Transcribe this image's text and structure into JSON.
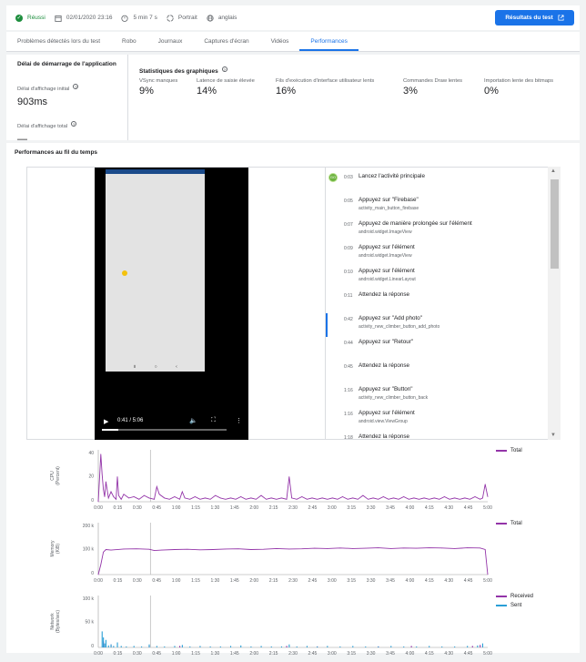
{
  "topbar": {
    "status": "Réussi",
    "date": "02/01/2020 23:16",
    "duration": "5 min 7 s",
    "orientation": "Portrait",
    "locale": "anglais",
    "results_button": "Résultats du test"
  },
  "tabs": [
    {
      "label": "Problèmes détectés lors du test"
    },
    {
      "label": "Robo"
    },
    {
      "label": "Journaux"
    },
    {
      "label": "Captures d'écran"
    },
    {
      "label": "Vidéos"
    },
    {
      "label": "Performances",
      "active": true
    }
  ],
  "startup": {
    "title": "Délai de démarrage de l'application",
    "initial_label": "Délai d'affichage initial",
    "initial_value": "903ms",
    "total_label": "Délai d'affichage total",
    "total_value": "—"
  },
  "graphics": {
    "title": "Statistiques des graphiques",
    "metrics": [
      {
        "label": "VSync manques",
        "value": "9%"
      },
      {
        "label": "Latence de saisie élevée",
        "value": "14%"
      },
      {
        "label": "Fils d'exécution d'interface utilisateur lents",
        "value": "16%"
      },
      {
        "label": "Commandes Draw lentes",
        "value": "3%"
      },
      {
        "label": "Importation lente des bitmaps",
        "value": "0%"
      }
    ]
  },
  "timeline": {
    "title": "Performances au fil du temps",
    "video": {
      "time": "0:41 / 5:06",
      "progress": 0.134
    },
    "go_badge": "GO",
    "actions": [
      {
        "time": "0:03",
        "desc": "Lancez l'activité principale",
        "sub": ""
      },
      {
        "time": "0:05",
        "desc": "Appuyez sur \"Firebase\"",
        "sub": "activity_main_button_firebase"
      },
      {
        "time": "0:07",
        "desc": "Appuyez de manière prolongée sur l'élément",
        "sub": "android.widget.ImageView"
      },
      {
        "time": "0:09",
        "desc": "Appuyez sur l'élément",
        "sub": "android.widget.ImageView"
      },
      {
        "time": "0:10",
        "desc": "Appuyez sur l'élément",
        "sub": "android.widget.LinearLayout"
      },
      {
        "time": "0:11",
        "desc": "Attendez la réponse",
        "sub": ""
      },
      {
        "time": "0:42",
        "desc": "Appuyez sur \"Add photo\"",
        "sub": "activity_new_climber_button_add_photo"
      },
      {
        "time": "0:44",
        "desc": "Appuyez sur \"Retour\"",
        "sub": ""
      },
      {
        "time": "0:45",
        "desc": "Attendez la réponse",
        "sub": ""
      },
      {
        "time": "1:16",
        "desc": "Appuyez sur \"Button\"",
        "sub": "activity_new_climber_button_back"
      },
      {
        "time": "1:16",
        "desc": "Appuyez sur l'élément",
        "sub": "android.view.ViewGroup"
      },
      {
        "time": "1:18",
        "desc": "Attendez la réponse",
        "sub": ""
      }
    ]
  },
  "chart_data": [
    {
      "type": "line",
      "ylabel": "CPU (Percent)",
      "yticks": [
        "40",
        "20",
        "0"
      ],
      "ylim": [
        0,
        40
      ],
      "xticks": [
        "0:00",
        "0:15",
        "0:30",
        "0:45",
        "1:00",
        "1:15",
        "1:30",
        "1:45",
        "2:00",
        "2:15",
        "2:30",
        "2:45",
        "3:00",
        "3:15",
        "3:30",
        "3:45",
        "4:00",
        "4:15",
        "4:30",
        "4:45",
        "5:00"
      ],
      "cursor": 41,
      "series": [
        {
          "name": "Total",
          "color": "#9334a8",
          "x": [
            0,
            2,
            3,
            4,
            5,
            6,
            8,
            10,
            12,
            14,
            15,
            16,
            18,
            20,
            24,
            28,
            32,
            36,
            40,
            44,
            46,
            48,
            52,
            56,
            60,
            64,
            66,
            68,
            72,
            76,
            80,
            84,
            88,
            92,
            96,
            100,
            104,
            108,
            112,
            116,
            120,
            124,
            128,
            132,
            136,
            140,
            144,
            148,
            150,
            152,
            156,
            160,
            164,
            168,
            172,
            176,
            180,
            184,
            188,
            192,
            196,
            200,
            204,
            208,
            212,
            216,
            220,
            224,
            228,
            232,
            236,
            240,
            244,
            248,
            252,
            256,
            260,
            264,
            268,
            272,
            276,
            280,
            284,
            288,
            292,
            296,
            300,
            302,
            304,
            306
          ],
          "values": [
            0,
            38,
            22,
            10,
            4,
            16,
            3,
            8,
            4,
            2,
            20,
            5,
            2,
            6,
            3,
            4,
            2,
            5,
            3,
            2,
            12,
            6,
            3,
            2,
            4,
            2,
            8,
            3,
            2,
            4,
            2,
            3,
            2,
            5,
            3,
            2,
            3,
            2,
            4,
            2,
            3,
            2,
            5,
            2,
            3,
            2,
            3,
            2,
            20,
            3,
            2,
            4,
            2,
            3,
            2,
            3,
            2,
            3,
            2,
            4,
            2,
            3,
            2,
            5,
            2,
            3,
            2,
            4,
            2,
            3,
            2,
            4,
            2,
            3,
            2,
            3,
            2,
            3,
            2,
            4,
            2,
            3,
            2,
            3,
            2,
            4,
            2,
            3,
            14,
            4
          ]
        }
      ]
    },
    {
      "type": "line",
      "ylabel": "Memory (KiB)",
      "yticks": [
        "200 k",
        "100 k",
        "0"
      ],
      "ylim": [
        0,
        200000
      ],
      "xticks": [
        "0:00",
        "0:15",
        "0:30",
        "0:45",
        "1:00",
        "1:15",
        "1:30",
        "1:45",
        "2:00",
        "2:15",
        "2:30",
        "2:45",
        "3:00",
        "3:15",
        "3:30",
        "3:45",
        "4:00",
        "4:15",
        "4:30",
        "4:45",
        "5:00"
      ],
      "cursor": 41,
      "series": [
        {
          "name": "Total",
          "color": "#9334a8",
          "x": [
            0,
            2,
            4,
            6,
            10,
            20,
            30,
            40,
            44,
            50,
            60,
            70,
            80,
            90,
            100,
            110,
            120,
            130,
            140,
            150,
            160,
            170,
            180,
            190,
            200,
            210,
            220,
            230,
            240,
            250,
            260,
            270,
            280,
            290,
            300,
            304,
            306
          ],
          "values": [
            0,
            40000,
            90000,
            100000,
            98000,
            102000,
            103000,
            101000,
            96000,
            98000,
            100000,
            101000,
            99000,
            100000,
            102000,
            103000,
            100000,
            101000,
            104000,
            102000,
            103000,
            105000,
            104000,
            106000,
            104000,
            105000,
            107000,
            104000,
            106000,
            105000,
            107000,
            106000,
            104000,
            107000,
            106000,
            100000,
            0
          ]
        }
      ]
    },
    {
      "type": "bar",
      "ylabel": "Network (Bytes/sec)",
      "yticks": [
        "100 k",
        "50 k",
        "0"
      ],
      "ylim": [
        0,
        100000
      ],
      "xticks": [
        "0:00",
        "0:15",
        "0:30",
        "0:45",
        "1:00",
        "1:15",
        "1:30",
        "1:45",
        "2:00",
        "2:15",
        "2:30",
        "2:45",
        "3:00",
        "3:15",
        "3:30",
        "3:45",
        "4:00",
        "4:15",
        "4:30",
        "4:45",
        "5:00"
      ],
      "cursor": 41,
      "series": [
        {
          "name": "Received",
          "color": "#9334a8",
          "x": [
            4,
            10,
            40,
            64,
            148,
            172,
            220,
            246,
            294,
            300
          ],
          "values": [
            12000,
            6000,
            4000,
            3000,
            3000,
            2000,
            2000,
            3000,
            3000,
            5000
          ]
        },
        {
          "name": "Sent",
          "color": "#2a9fd6",
          "x": [
            3,
            4,
            5,
            6,
            8,
            10,
            12,
            15,
            18,
            22,
            28,
            34,
            40,
            46,
            52,
            60,
            66,
            72,
            80,
            88,
            96,
            104,
            112,
            120,
            128,
            136,
            144,
            150,
            156,
            164,
            172,
            180,
            190,
            200,
            210,
            220,
            230,
            240,
            250,
            260,
            270,
            280,
            290,
            298,
            302
          ],
          "values": [
            32000,
            20000,
            8000,
            15000,
            4000,
            6000,
            3000,
            10000,
            3000,
            2000,
            3000,
            2000,
            6000,
            3000,
            2000,
            3000,
            5000,
            2000,
            3000,
            2000,
            2000,
            3000,
            4000,
            2000,
            3000,
            2000,
            2000,
            6000,
            2000,
            3000,
            2000,
            3000,
            2000,
            3000,
            2000,
            2000,
            3000,
            2000,
            2000,
            3000,
            2000,
            2000,
            3000,
            4000,
            8000
          ]
        }
      ]
    }
  ]
}
